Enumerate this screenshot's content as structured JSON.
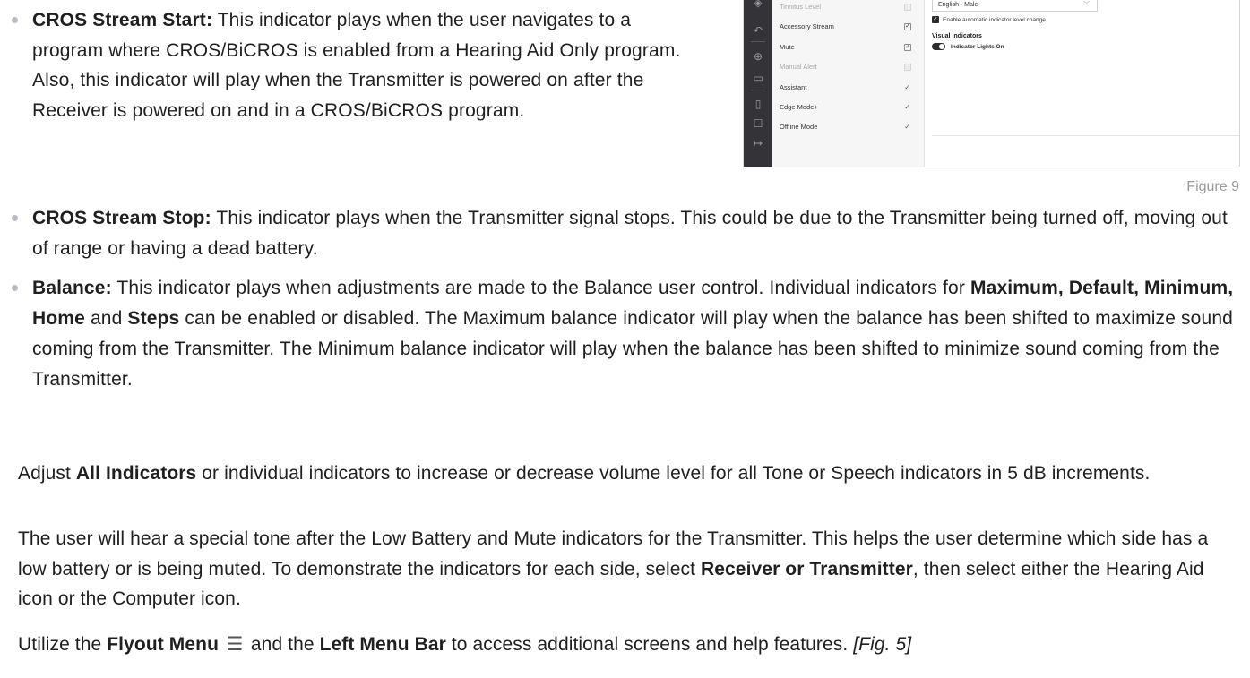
{
  "cros_start": {
    "term": "CROS Stream Start:",
    "text": " This indicator plays when the user navigates to a program where CROS/BiCROS is enabled from a Hearing Aid Only program. Also, this indicator will play when the Transmitter is powered on after the Receiver is powered on and in a CROS/BiCROS program."
  },
  "figure": {
    "list_items": [
      {
        "label": "Tinnitus Level",
        "state": "unchecked-disabled",
        "muted": true
      },
      {
        "label": "Accessory Stream",
        "state": "checked",
        "muted": false
      },
      {
        "label": "Mute",
        "state": "checked",
        "muted": false
      },
      {
        "label": "Manual Alert",
        "state": "unchecked-disabled",
        "muted": true
      },
      {
        "label": "Assistant",
        "state": "tick",
        "muted": false
      },
      {
        "label": "Edge Mode+",
        "state": "tick",
        "muted": false
      },
      {
        "label": "Offline Mode",
        "state": "tick",
        "muted": false
      }
    ],
    "language_select": "English - Male",
    "auto_level_label": "Enable automatic indicator level change",
    "visual_heading": "Visual Indicators",
    "indicator_lights": "Indicator Lights On",
    "caption": "Figure 9"
  },
  "cros_stop": {
    "term": "CROS Stream Stop:",
    "text": " This indicator plays when the Transmitter signal stops. This could be due to the Transmitter being turned off, moving out of range or having a dead battery."
  },
  "balance": {
    "term": "Balance:",
    "text_1": " This indicator plays when adjustments are made to the Balance user control. Individual indicators for ",
    "bold_1": "Maximum, Default, Minimum, Home",
    "text_2": " and ",
    "bold_2": "Steps",
    "text_3": " can be enabled or disabled. The Maximum balance indicator will play when the balance has been shifted to maximize sound coming from the Transmitter. The Minimum balance indicator will play when the balance has been shifted to minimize sound coming from the Transmitter."
  },
  "para_adjust": {
    "text_1": "Adjust ",
    "bold": "All Indicators",
    "text_2": " or individual indicators to increase or decrease volume level for all Tone or Speech indicators in 5 dB increments."
  },
  "para_user": {
    "text_1": "The user will hear a special tone after the Low Battery and Mute indicators for the Transmitter. This helps the user determine which side has a low battery or is being muted. To demonstrate the indicators for each side, select ",
    "bold": "Receiver or Transmitter",
    "text_2": ", then select either the Hearing Aid icon or the Computer icon."
  },
  "para_flyout": {
    "text_1": "Utilize the ",
    "bold_1": "Flyout Menu",
    "text_2": " and the ",
    "bold_2": "Left Menu Bar",
    "text_3": " to access additional screens and help features. ",
    "italic": "[Fig. 5]"
  }
}
